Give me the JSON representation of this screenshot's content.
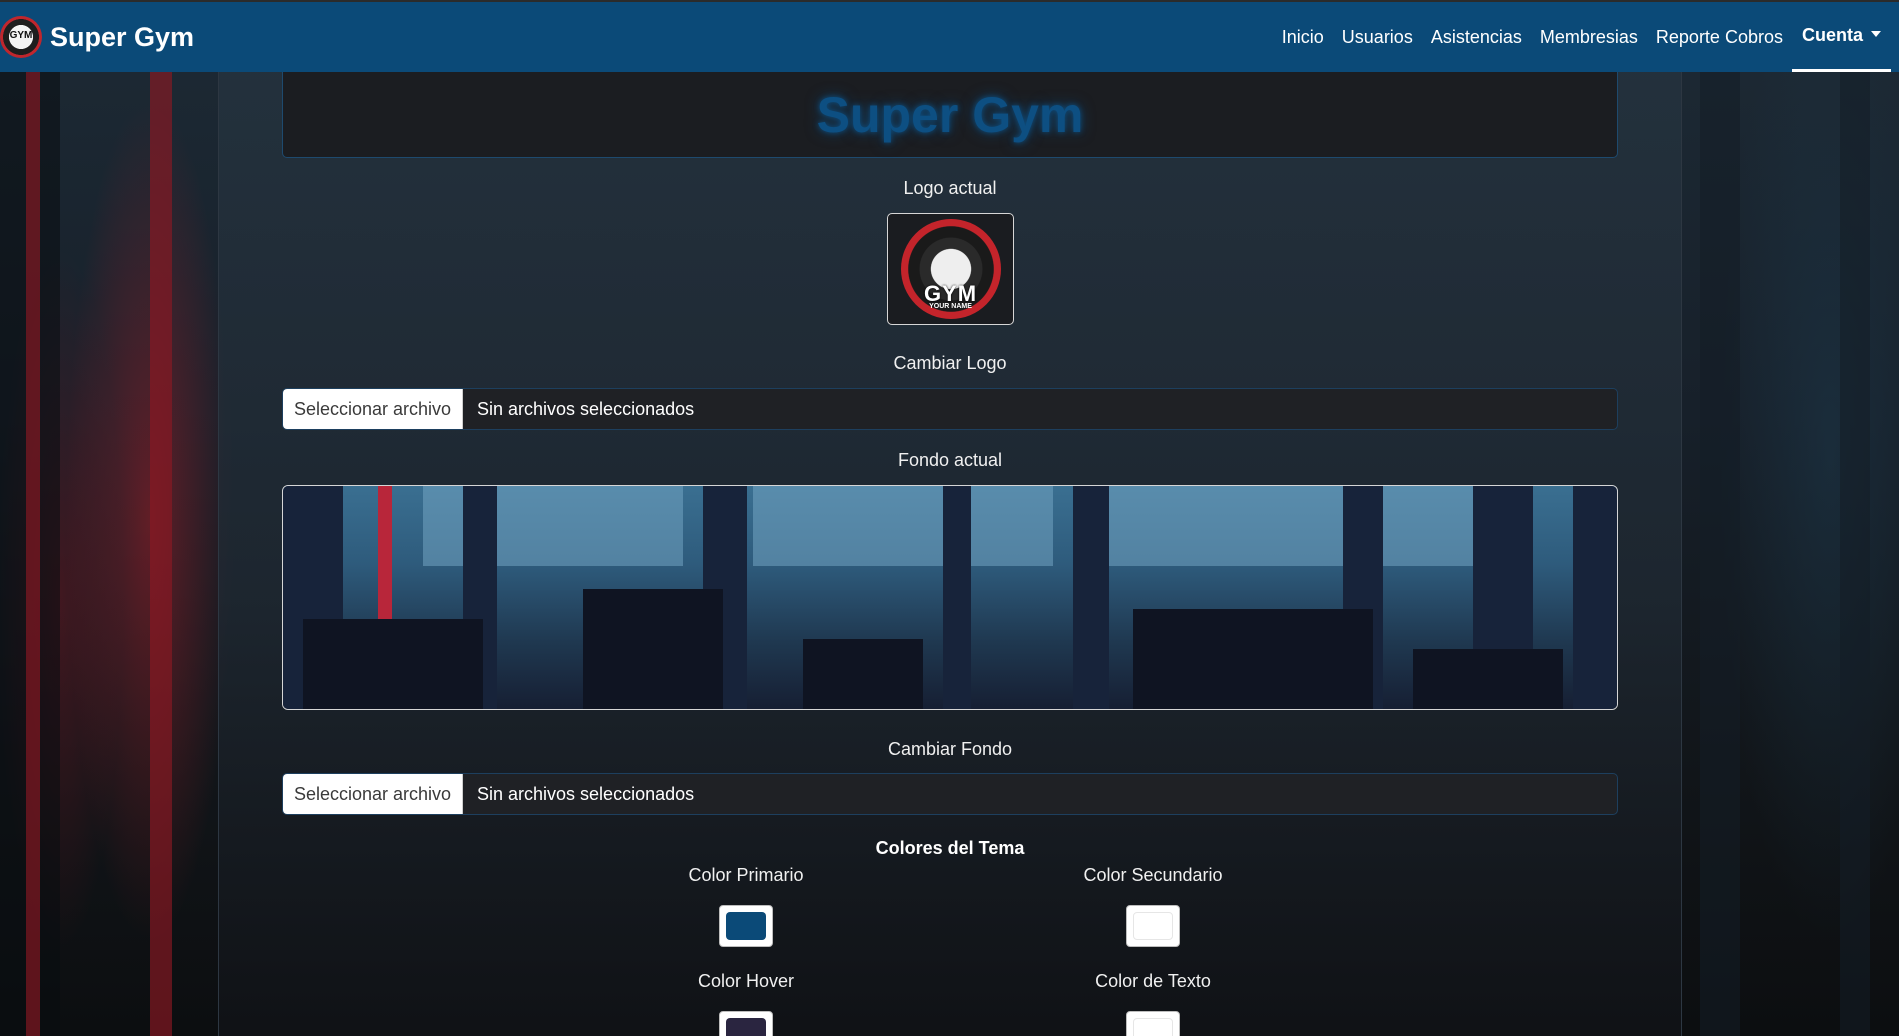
{
  "brand": {
    "name": "Super Gym",
    "logo_text": "GYM"
  },
  "nav": {
    "links": [
      "Inicio",
      "Usuarios",
      "Asistencias",
      "Membresias",
      "Reporte Cobros"
    ],
    "account": "Cuenta"
  },
  "page": {
    "title": "Super Gym",
    "logo_label": "Logo actual",
    "logo_emblem_text": "GYM",
    "logo_emblem_sub": "YOUR NAME",
    "change_logo_label": "Cambiar Logo",
    "background_label": "Fondo actual",
    "change_background_label": "Cambiar Fondo",
    "file_button": "Seleccionar archivo",
    "file_status": "Sin archivos seleccionados",
    "theme_section": "Colores del Tema"
  },
  "colors": [
    {
      "label": "Color Primario",
      "value": "#0b4a78"
    },
    {
      "label": "Color Secundario",
      "value": "#ffffff"
    },
    {
      "label": "Color Hover",
      "value": "#2a2540"
    },
    {
      "label": "Color de Texto",
      "value": "#ffffff"
    }
  ],
  "theme": {
    "navbar_bg": "#0b4a78",
    "title_glow": "#0d4f82"
  }
}
